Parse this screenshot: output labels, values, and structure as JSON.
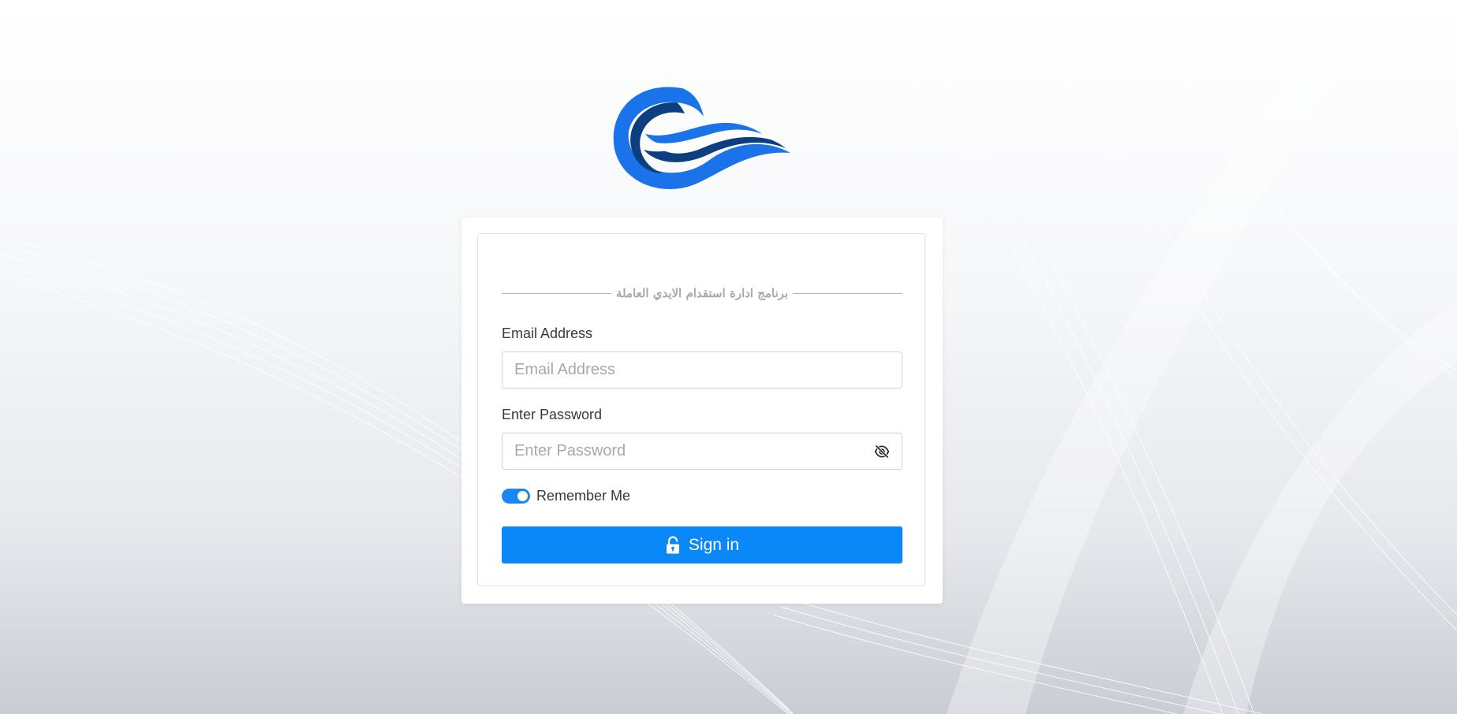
{
  "form": {
    "title": "برنامج ادارة استقدام الايدي العاملة",
    "email": {
      "label": "Email Address",
      "placeholder": "Email Address",
      "value": ""
    },
    "password": {
      "label": "Enter Password",
      "placeholder": "Enter Password",
      "value": "",
      "toggle_icon": "eye-slash-icon"
    },
    "remember": {
      "label": "Remember Me",
      "checked": true
    },
    "submit": {
      "label": "Sign in",
      "icon": "unlock-icon"
    }
  },
  "colors": {
    "primary": "#0a88f7",
    "logo_blue": "#1a73e8",
    "logo_navy": "#0d3f80"
  }
}
